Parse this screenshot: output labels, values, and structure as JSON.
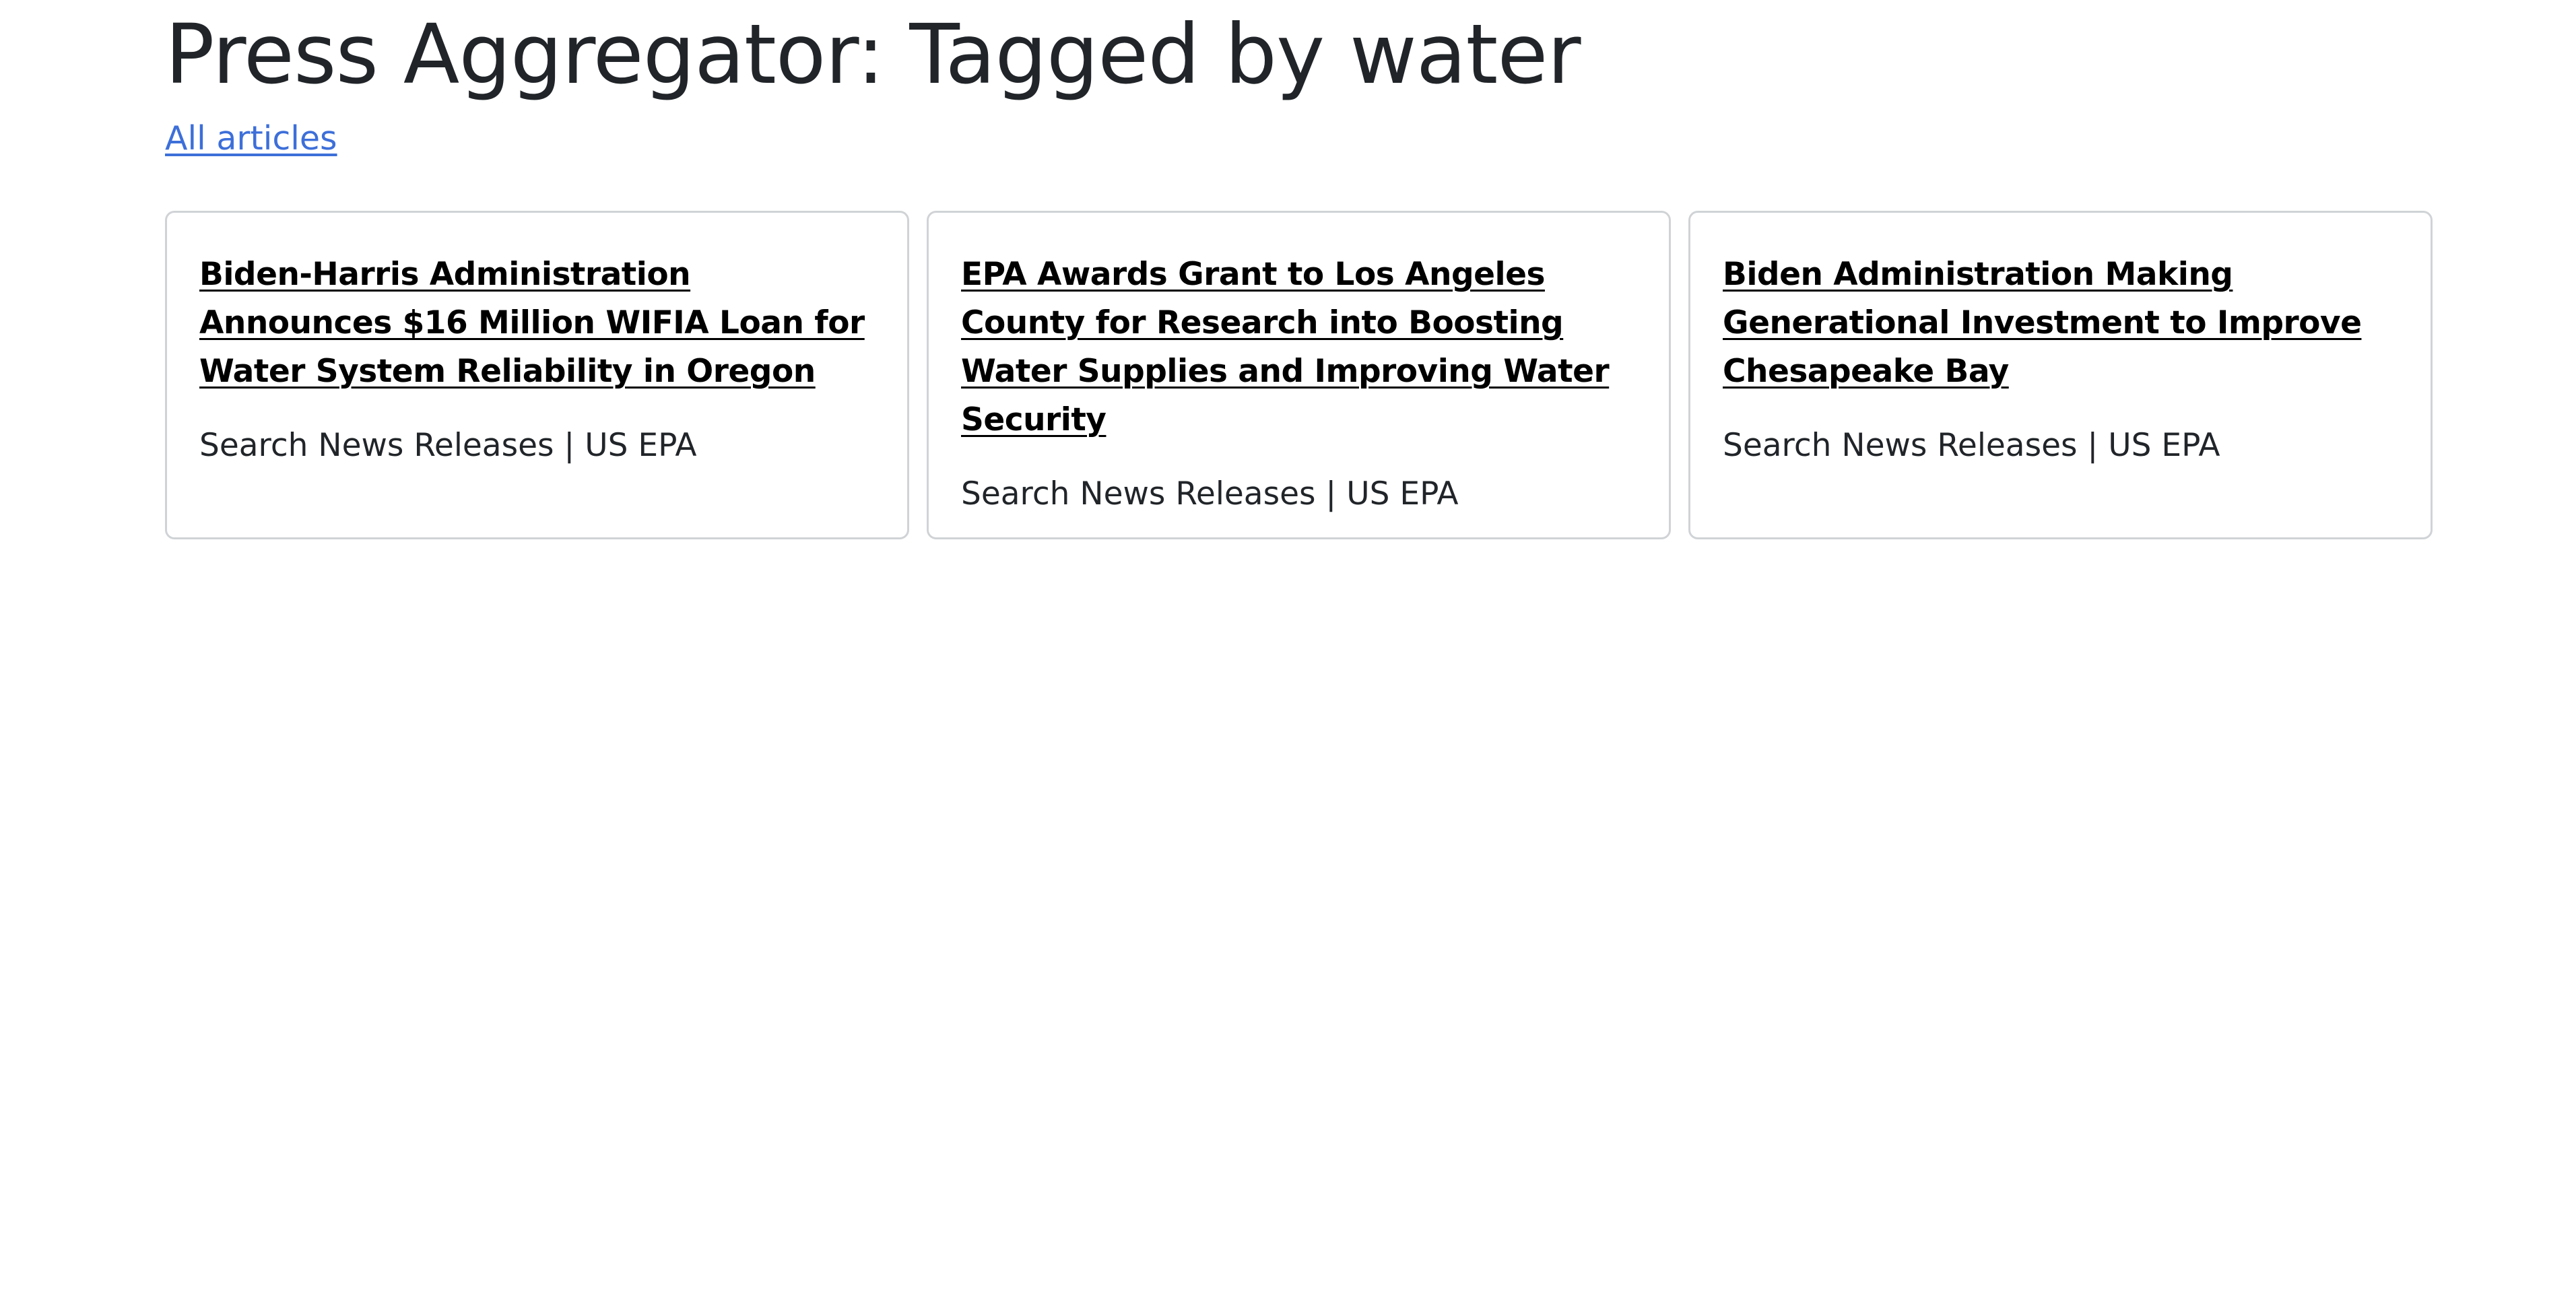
{
  "header": {
    "title": "Press Aggregator: Tagged by water",
    "all_articles_link": "All articles"
  },
  "articles": [
    {
      "title": "Biden-Harris Administration Announces $16 Million WIFIA Loan for Water System Reliability in Oregon",
      "source": "Search News Releases | US EPA"
    },
    {
      "title": "EPA Awards Grant to Los Angeles County for Research into Boosting Water Supplies and Improving Water Security",
      "source": "Search News Releases | US EPA"
    },
    {
      "title": "Biden Administration Making Generational Investment to Improve Chesapeake Bay",
      "source": "Search News Releases | US EPA"
    }
  ]
}
